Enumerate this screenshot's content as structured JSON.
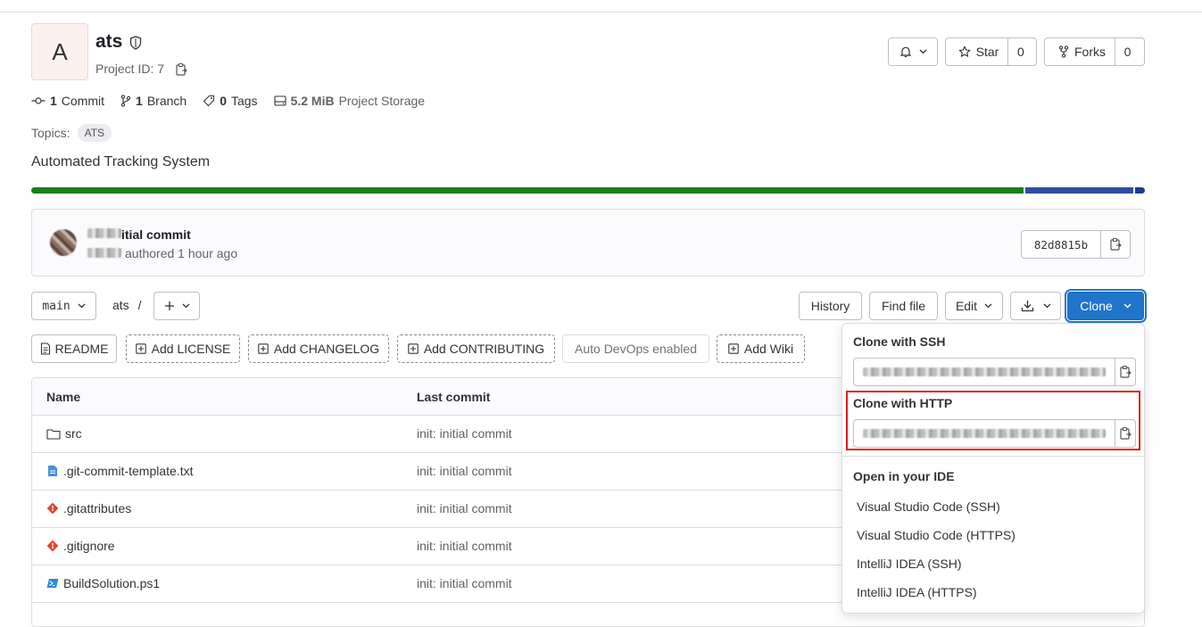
{
  "project": {
    "avatar_letter": "A",
    "name": "ats",
    "id_label": "Project ID: 7"
  },
  "header_buttons": {
    "notification_icon": "bell-icon",
    "star_label": "Star",
    "star_count": "0",
    "forks_label": "Forks",
    "forks_count": "0"
  },
  "stats": {
    "commits_count": "1",
    "commits_label": "Commit",
    "branches_count": "1",
    "branches_label": "Branch",
    "tags_count": "0",
    "tags_label": "Tags",
    "storage_size": "5.2 MiB",
    "storage_label": "Project Storage"
  },
  "topics": {
    "label": "Topics:",
    "items": [
      "ATS"
    ]
  },
  "description": "Automated Tracking System",
  "language_bar": {
    "colors": [
      "#1a7f1a",
      "#2f4ea0",
      "#1c3d8a"
    ],
    "shares": [
      0.894,
      0.097,
      0.009
    ]
  },
  "last_commit": {
    "title": "itial commit",
    "meta": "authored 1 hour ago",
    "sha": "82d8815b"
  },
  "toolbar": {
    "branch": "main",
    "path_root": "ats",
    "path_sep": "/",
    "history": "History",
    "find_file": "Find file",
    "edit": "Edit",
    "clone": "Clone"
  },
  "quick_links": {
    "readme": "README",
    "add_license": "Add LICENSE",
    "add_changelog": "Add CHANGELOG",
    "add_contributing": "Add CONTRIBUTING",
    "auto_devops": "Auto DevOps enabled",
    "add_wiki": "Add Wiki"
  },
  "table": {
    "headers": {
      "name": "Name",
      "last_commit": "Last commit"
    },
    "rows": [
      {
        "name": "src",
        "icon": "folder-icon",
        "last_commit": "init: initial commit"
      },
      {
        "name": ".git-commit-template.txt",
        "icon": "file-text-icon",
        "last_commit": "init: initial commit"
      },
      {
        "name": ".gitattributes",
        "icon": "git-icon",
        "last_commit": "init: initial commit"
      },
      {
        "name": ".gitignore",
        "icon": "git-icon",
        "last_commit": "init: initial commit"
      },
      {
        "name": "BuildSolution.ps1",
        "icon": "powershell-icon",
        "last_commit": "init: initial commit"
      }
    ]
  },
  "clone_dropdown": {
    "ssh_label": "Clone with SSH",
    "http_label": "Clone with HTTP",
    "ide_label": "Open in your IDE",
    "ide_options": [
      "Visual Studio Code (SSH)",
      "Visual Studio Code (HTTPS)",
      "IntelliJ IDEA (SSH)",
      "IntelliJ IDEA (HTTPS)"
    ],
    "highlight_color": "#e01b1b"
  },
  "colors": {
    "primary": "#1f75cb",
    "language_green": "#1a7f1a",
    "language_blue": "#2f4ea0"
  }
}
